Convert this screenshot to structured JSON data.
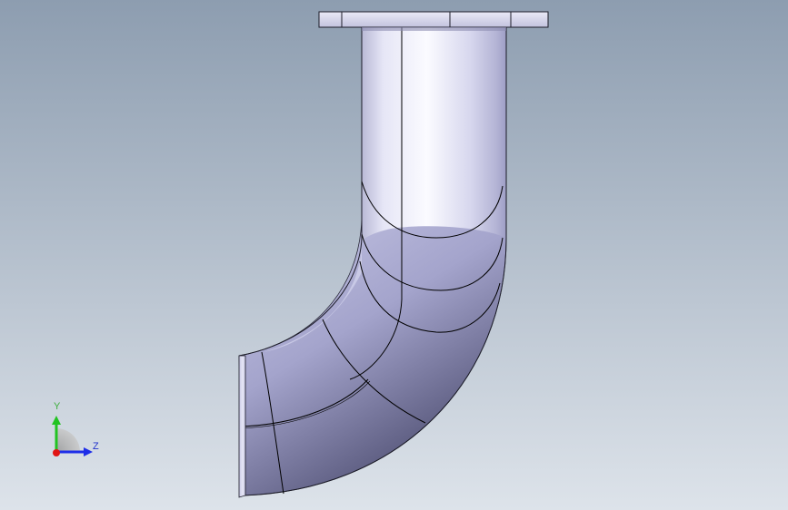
{
  "viewport": {
    "background_top": "#8d9db0",
    "background_bottom": "#dde3ea",
    "model": "elbow-pipe-with-flange",
    "part_fill_light": "#f7f7ff",
    "part_fill_mid": "#c5c6e4",
    "part_fill_dark": "#6f6f93",
    "edge_color": "#000000"
  },
  "triad": {
    "y_label": "Y",
    "z_label": "Z",
    "y_color": "#22c322",
    "z_color": "#1e2ee8",
    "x_color": "#e01414",
    "y_label_color": "#3fae3f",
    "z_label_color": "#2233cc"
  }
}
